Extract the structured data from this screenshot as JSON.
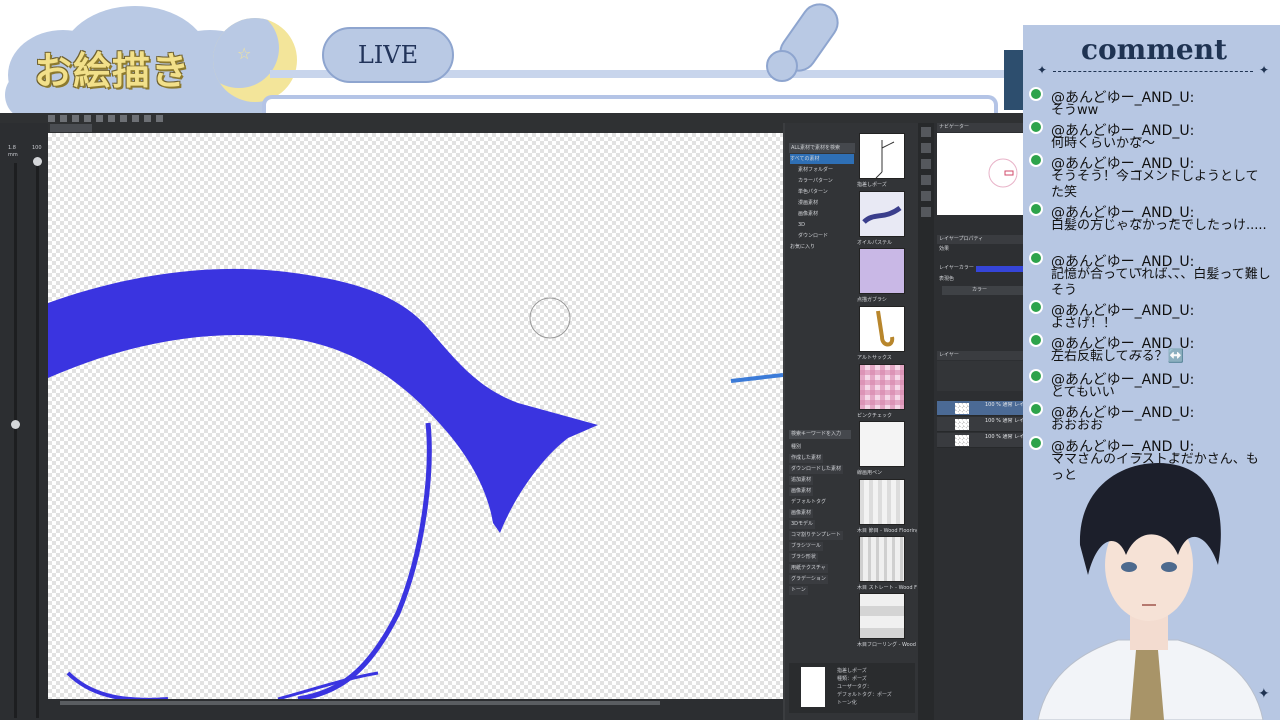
{
  "overlay": {
    "title": "お絵描き",
    "live_label": "LIVE"
  },
  "app": {
    "zoom_values": [
      "1.8",
      "mm"
    ],
    "brush_size": "100"
  },
  "materials": {
    "header": "ALL素材で素材を検索",
    "tree": [
      "すべての素材",
      "素材フォルダー",
      "カラーパターン",
      "単色パターン",
      "漫画素材",
      "画像素材",
      "3D",
      "ダウンロード",
      "お気に入り"
    ],
    "thumbnails": [
      {
        "label": "指差しポーズ"
      },
      {
        "label": "オイルパステル"
      },
      {
        "label": "点描ガブラシ"
      },
      {
        "label": "アルトサックス"
      },
      {
        "label": "ピンクチェック"
      },
      {
        "label": "線画用ペン"
      },
      {
        "label": "木目 節目 - Wood Flooring"
      },
      {
        "label": "木目 ストレート - Wood Floo"
      },
      {
        "label": "木目フローリング - Wood Floo"
      }
    ],
    "search_placeholder": "検索キーワードを入力",
    "tags": [
      "種別",
      "作成した素材",
      "ダウンロードした素材",
      "追加素材",
      "画像素材",
      "デフォルトタグ",
      "画像素材",
      "3Dモデル",
      "コマ割りテンプレート",
      "ブラシツール",
      "ブラシ形状",
      "用紙テクスチャ",
      "グラデーション",
      "トーン"
    ],
    "detail": [
      "指差しポーズ",
      "種類：ポーズ",
      "ユーザータグ：",
      "デフォルトタグ：ポーズ",
      "トーン化"
    ]
  },
  "panels": {
    "navigator": "ナビゲーター",
    "property": "レイヤープロパティ",
    "prop_rows": [
      "効果",
      "レイヤーカラー",
      "表現色",
      "カラー"
    ],
    "layer": "レイヤー",
    "layers": [
      {
        "name": "100 % 通常 レイヤー"
      },
      {
        "name": "100 % 通常 レイヤー 1"
      },
      {
        "name": "100 % 通常 レイヤー"
      }
    ]
  },
  "chat": {
    "title": "comment",
    "messages": [
      {
        "name": "@あんどゆー_AND_U:",
        "text": "そうww"
      },
      {
        "name": "@あんどゆー_AND_U:",
        "text": "何時くらいかな～"
      },
      {
        "name": "@あんどゆー_AND_U:",
        "text": "そうそう！今コメントしようとしてた笑"
      },
      {
        "name": "@あんどゆー_AND_U:",
        "text": "白髪の方じゃなかったでしたっけ....."
      },
      {
        "name": "@あんどゆー_AND_U:",
        "text": "記憶が合っていれば、、、白髪って難しそう"
      },
      {
        "name": "@あんどゆー_AND_U:",
        "text": "よさげ！！"
      },
      {
        "name": "@あんどゆー_AND_U:",
        "text": "左右反転してみる？↔️"
      },
      {
        "name": "@あんどゆー_AND_U:",
        "text": "とてもいい"
      },
      {
        "name": "@あんどゆー_AND_U:",
        "text": "おおおお"
      },
      {
        "name": "@あんどゆー_AND_U:",
        "text": "ママさんのイラストよだかさん、もっと"
      }
    ]
  },
  "colors": {
    "stroke": "#3a34e0",
    "overlay_blue": "#b9c9e4",
    "chat_bg": "#b7c7e3"
  }
}
